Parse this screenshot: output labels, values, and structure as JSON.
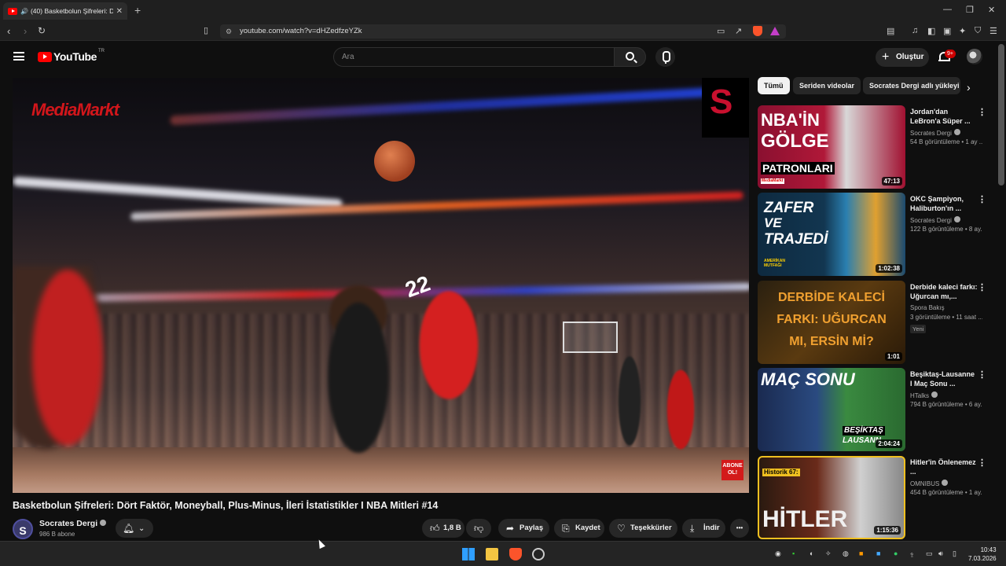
{
  "browser": {
    "tab_title": "(40) Basketbolun Şifreleri: Dört",
    "tab_close": "✕",
    "new_tab": "+",
    "url": "youtube.com/watch?v=dHZedfzeYZk",
    "window_controls": [
      "—",
      "❐",
      "✕"
    ]
  },
  "youtube": {
    "logo_text": "YouTube",
    "country_code": "TR",
    "search_placeholder": "Ara",
    "create_label": "Oluştur",
    "notification_count": "9+"
  },
  "video": {
    "title": "Basketbolun Şifreleri: Dört Faktör, Moneyball, Plus-Minus, İleri İstatistikler I NBA Mitleri #14",
    "overlay_brand": "MediaMarkt",
    "overlay_channel_letter": "S",
    "overlay_subscribe": "ABONE OL!",
    "jersey_number": "22"
  },
  "channel": {
    "avatar_letter": "S",
    "name": "Socrates Dergi",
    "subscribers": "986 B abone"
  },
  "actions": {
    "like_count": "1,8 B",
    "share": "Paylaş",
    "save": "Kaydet",
    "thanks": "Teşekkürler",
    "download": "İndir",
    "more": "•••"
  },
  "chips": [
    "Tümü",
    "Seriden videolar",
    "Socrates Dergi adlı yükleyi"
  ],
  "recommendations": [
    {
      "title": "Jordan'dan LeBron'a Süper ...",
      "channel": "Socrates Dergi",
      "meta": "54 B görüntüleme • 1 ay ...",
      "duration": "47:13",
      "thumb_lines": [
        "NBA'İN",
        "GÖLGE",
        "PATRONLARI"
      ],
      "thumb_tag": "MediaMarkt"
    },
    {
      "title": "OKC Şampiyon, Haliburton'ın ...",
      "channel": "Socrates Dergi",
      "meta": "122 B görüntüleme • 8 ay...",
      "duration": "1:02:38",
      "thumb_lines": [
        "ZAFER",
        "VE",
        "TRAJEDİ"
      ],
      "thumb_tag": "AMERİKAN MUTFAĞI"
    },
    {
      "title": "Derbide kaleci farkı: Uğurcan mı,...",
      "channel": "Spora Bakış",
      "meta": "3 görüntüleme • 11 saat ...",
      "badge": "Yeni",
      "duration": "1:01",
      "thumb_lines": [
        "DERBİDE KALECİ",
        "FARKI: UĞURCAN",
        "MI, ERSİN Mİ?"
      ]
    },
    {
      "title": "Beşiktaş-Lausanne I Maç Sonu ...",
      "channel": "HTalks",
      "meta": "794 B görüntüleme • 6 ay...",
      "duration": "2:04:24",
      "thumb_lines": [
        "MAÇ SONU",
        "BEŞİKTAŞ",
        "LAUSANN"
      ]
    },
    {
      "title": "Hitler'in Önlenemez ...",
      "channel": "OMNIBUS",
      "meta": "454 B görüntüleme • 1 ay...",
      "duration": "1:15:36",
      "thumb_lines": [
        "Historik 67:",
        "HİTLER"
      ]
    }
  ],
  "taskbar": {
    "time": "10:43",
    "date": "7.03.2026"
  },
  "colors": {
    "yt_red": "#ff0000",
    "background": "#0f0f0f",
    "chip_active": "#f1f1f1",
    "brave_orange": "#fb542b"
  }
}
